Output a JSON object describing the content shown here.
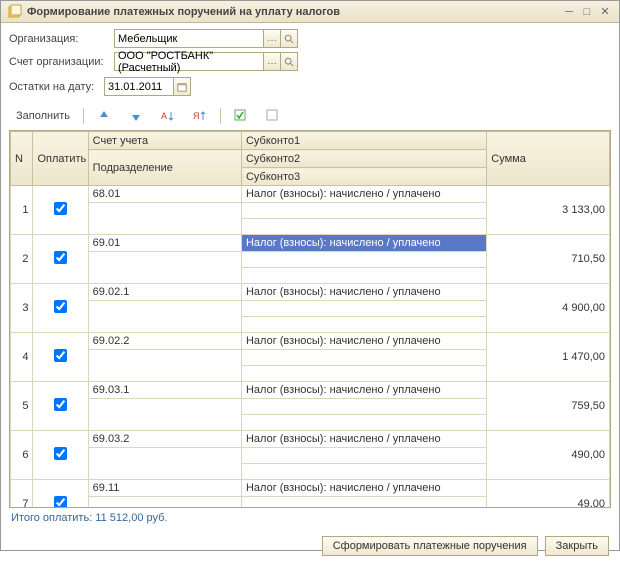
{
  "window": {
    "title": "Формирование платежных поручений на уплату налогов"
  },
  "labels": {
    "organization": "Организация:",
    "account": "Счет организации:",
    "balance_date": "Остатки на дату:",
    "fill": "Заполнить",
    "total_prefix": "Итого оплатить: ",
    "form_payments": "Сформировать платежные поручения",
    "close": "Закрыть"
  },
  "fields": {
    "organization": "Мебельщик",
    "account": "ООО \"РОСТБАНК\" (Расчетный)",
    "balance_date": "31.01.2011"
  },
  "grid": {
    "headers": {
      "n": "N",
      "pay": "Оплатить",
      "account": "Счет учета",
      "subdiv": "Подразделение",
      "sub1": "Субконто1",
      "sub2": "Субконто2",
      "sub3": "Субконто3",
      "sum": "Сумма"
    },
    "rows": [
      {
        "n": "1",
        "pay": true,
        "account": "68.01",
        "sub1": "Налог (взносы): начислено / уплачено",
        "sum": "3 133,00",
        "selected": false
      },
      {
        "n": "2",
        "pay": true,
        "account": "69.01",
        "sub1": "Налог (взносы): начислено / уплачено",
        "sum": "710,50",
        "selected": true
      },
      {
        "n": "3",
        "pay": true,
        "account": "69.02.1",
        "sub1": "Налог (взносы): начислено / уплачено",
        "sum": "4 900,00",
        "selected": false
      },
      {
        "n": "4",
        "pay": true,
        "account": "69.02.2",
        "sub1": "Налог (взносы): начислено / уплачено",
        "sum": "1 470,00",
        "selected": false
      },
      {
        "n": "5",
        "pay": true,
        "account": "69.03.1",
        "sub1": "Налог (взносы): начислено / уплачено",
        "sum": "759,50",
        "selected": false
      },
      {
        "n": "6",
        "pay": true,
        "account": "69.03.2",
        "sub1": "Налог (взносы): начислено / уплачено",
        "sum": "490,00",
        "selected": false
      },
      {
        "n": "7",
        "pay": true,
        "account": "69.11",
        "sub1": "Налог (взносы): начислено / уплачено",
        "sum": "49,00",
        "selected": false
      }
    ]
  },
  "total": "11 512,00 руб."
}
